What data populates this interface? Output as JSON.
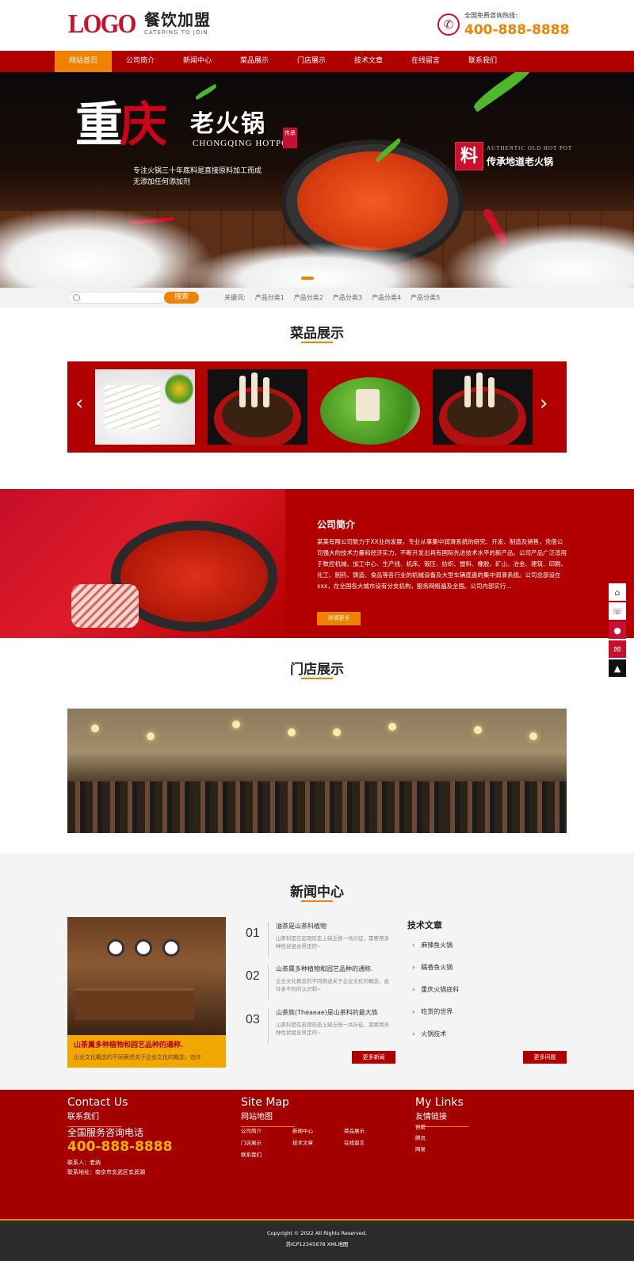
{
  "header": {
    "logo_main": "LOGO",
    "logo_cn": "餐饮加盟",
    "logo_en": "CATERING TO JOIN",
    "hotline_label": "全国免费咨询热线:",
    "hotline_number": "400-888-8888"
  },
  "nav": {
    "items": [
      {
        "label": "网站首页"
      },
      {
        "label": "公司简介"
      },
      {
        "label": "新闻中心"
      },
      {
        "label": "菜品展示"
      },
      {
        "label": "门店展示"
      },
      {
        "label": "技术文章"
      },
      {
        "label": "在线留言"
      },
      {
        "label": "联系我们"
      }
    ]
  },
  "banner": {
    "title_a": "重",
    "title_b": "庆",
    "title_sub": "老火锅",
    "title_en": "CHONGQING HOTPOT",
    "seal": "传承",
    "desc_line1": "专注火锅三十年底料是直接原料加工而成",
    "desc_line2": "无添加任何添加剂",
    "badge": "料",
    "badge_en": "AUTHENTIC OLD HOT POT",
    "badge_cn": "传承地道老火锅"
  },
  "search": {
    "placeholder": "",
    "button": "搜索",
    "keywords_label": "关键词:",
    "keywords": [
      "产品分类1",
      "产品分类2",
      "产品分类3",
      "产品分类4",
      "产品分类5"
    ]
  },
  "products": {
    "title": "菜品展示",
    "prev": "‹",
    "next": "›"
  },
  "about": {
    "title": "公司简介",
    "text": "某某有限公司致力于XX业的发展，专业从事集中润滑系统的研究、开发、制造及销售，凭借公司强大的技术力量和经济实力，不断开发出具有国际先进技术水平的新产品。公司产品广泛适用于数控机械、加工中心、生产线、机床、锻压、纺织、塑料、橡胶、矿山、冶金、建筑、印刷、化工、制药、铸造、食品等各行业的机械设备及大型车辆底盘的集中润滑系统。公司总部设在xxx，在全国各大城市设有分支机构，服务网络遍及全国。公司内部实行...",
    "button": "详情更多"
  },
  "stores": {
    "title": "门店展示"
  },
  "news": {
    "title": "新闻中心",
    "caption_title": "山茶属多种植物和园艺品种的通称.",
    "caption_desc": "企业文化概念的不同表述关于企业文化的概念，由许",
    "items": [
      {
        "num": "01",
        "title": "油茶是山茶科植物",
        "desc": "山茶科是在宏观形态上缺乏统一共衍征，需要用多种性状组合界定的~"
      },
      {
        "num": "02",
        "title": "山茶属多种植物和园艺品种的通称.",
        "desc": "企业文化概念的不同表述关于企业文化的概念，由许多不同的认识和~"
      },
      {
        "num": "03",
        "title": "山茶族(Theaeae)是山茶科的最大族",
        "desc": "山茶科是在宏观形态上缺乏统一共衍征，需要用多种性状组合界定的~"
      }
    ],
    "more_news": "更多新闻",
    "tech_title": "技术文章",
    "tech_items": [
      "麻辣鱼火锅",
      "糯香鱼火锅",
      "重庆火锅底料",
      "吃货的世界",
      "火锅技术"
    ],
    "more_questions": "更多问题"
  },
  "footer": {
    "contact_en": "Contact Us",
    "contact_cn": "联系我们",
    "tel_label": "全国服务咨询电话",
    "tel": "400-888-8888",
    "person": "联系人：老纳",
    "address": "联系地址：南京市玄武区玄武湖",
    "sitemap_en": "Site Map",
    "sitemap_cn": "网站地图",
    "sitemap_links": [
      "公司简介",
      "新闻中心",
      "菜品展示",
      "门店展示",
      "技术文章",
      "在线留言",
      "联系我们"
    ],
    "links_en": "My Links",
    "links_cn": "友情链接",
    "friend_links": [
      "百度",
      "腾讯",
      "网易"
    ]
  },
  "copyright": {
    "line1": "Copyright © 2022 All Rights Reserved.",
    "line2": "苏ICP12345678 XML地图"
  },
  "colors": {
    "brand_red": "#b00000",
    "accent_orange": "#f08200"
  }
}
